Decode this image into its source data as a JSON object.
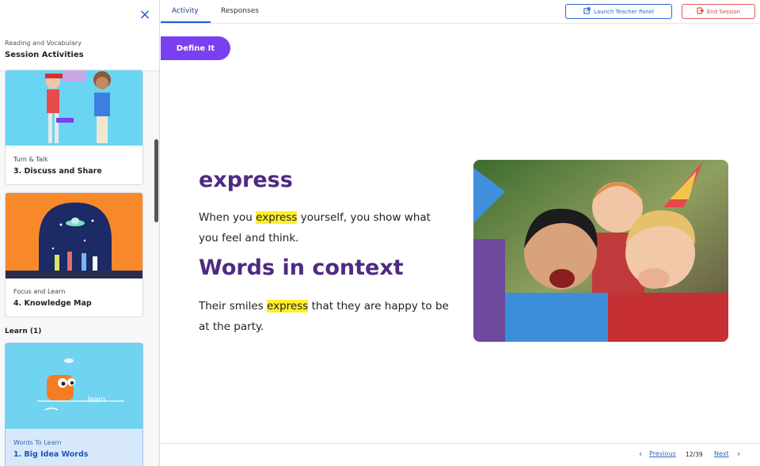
{
  "sidebar": {
    "breadcrumb": "Reading and Vocabulary",
    "title": "Session Activities",
    "close_icon": "×",
    "cards": [
      {
        "category": "Turn & Talk",
        "name": "3. Discuss and Share"
      },
      {
        "category": "Focus and Learn",
        "name": "4. Knowledge Map"
      }
    ],
    "section_label": "Learn (1)",
    "active_card": {
      "category": "Words To Learn",
      "name": "1. Big Idea Words",
      "thumb_text": "learn"
    }
  },
  "header": {
    "tabs": [
      {
        "label": "Activity"
      },
      {
        "label": "Responses"
      }
    ],
    "launch_label": "Launch Teacher Panel",
    "end_label": "End Session"
  },
  "content": {
    "define_label": "Define It",
    "word": "express",
    "definition": {
      "before": "When you ",
      "highlight": "express",
      "after": " yourself, you show what you feel and think."
    },
    "context_title": "Words in context",
    "context_sentence": {
      "before": "Their smiles ",
      "highlight": "express",
      "after": " that they are happy to be at the party."
    }
  },
  "footer": {
    "previous_label": "Previous",
    "page": "12/39",
    "next_label": "Next"
  },
  "colors": {
    "accent": "#1f5fd1",
    "purple_button": "#7a3ff0",
    "heading": "#4f2a83",
    "highlight": "#ffef2a",
    "end_red": "#d44646"
  }
}
